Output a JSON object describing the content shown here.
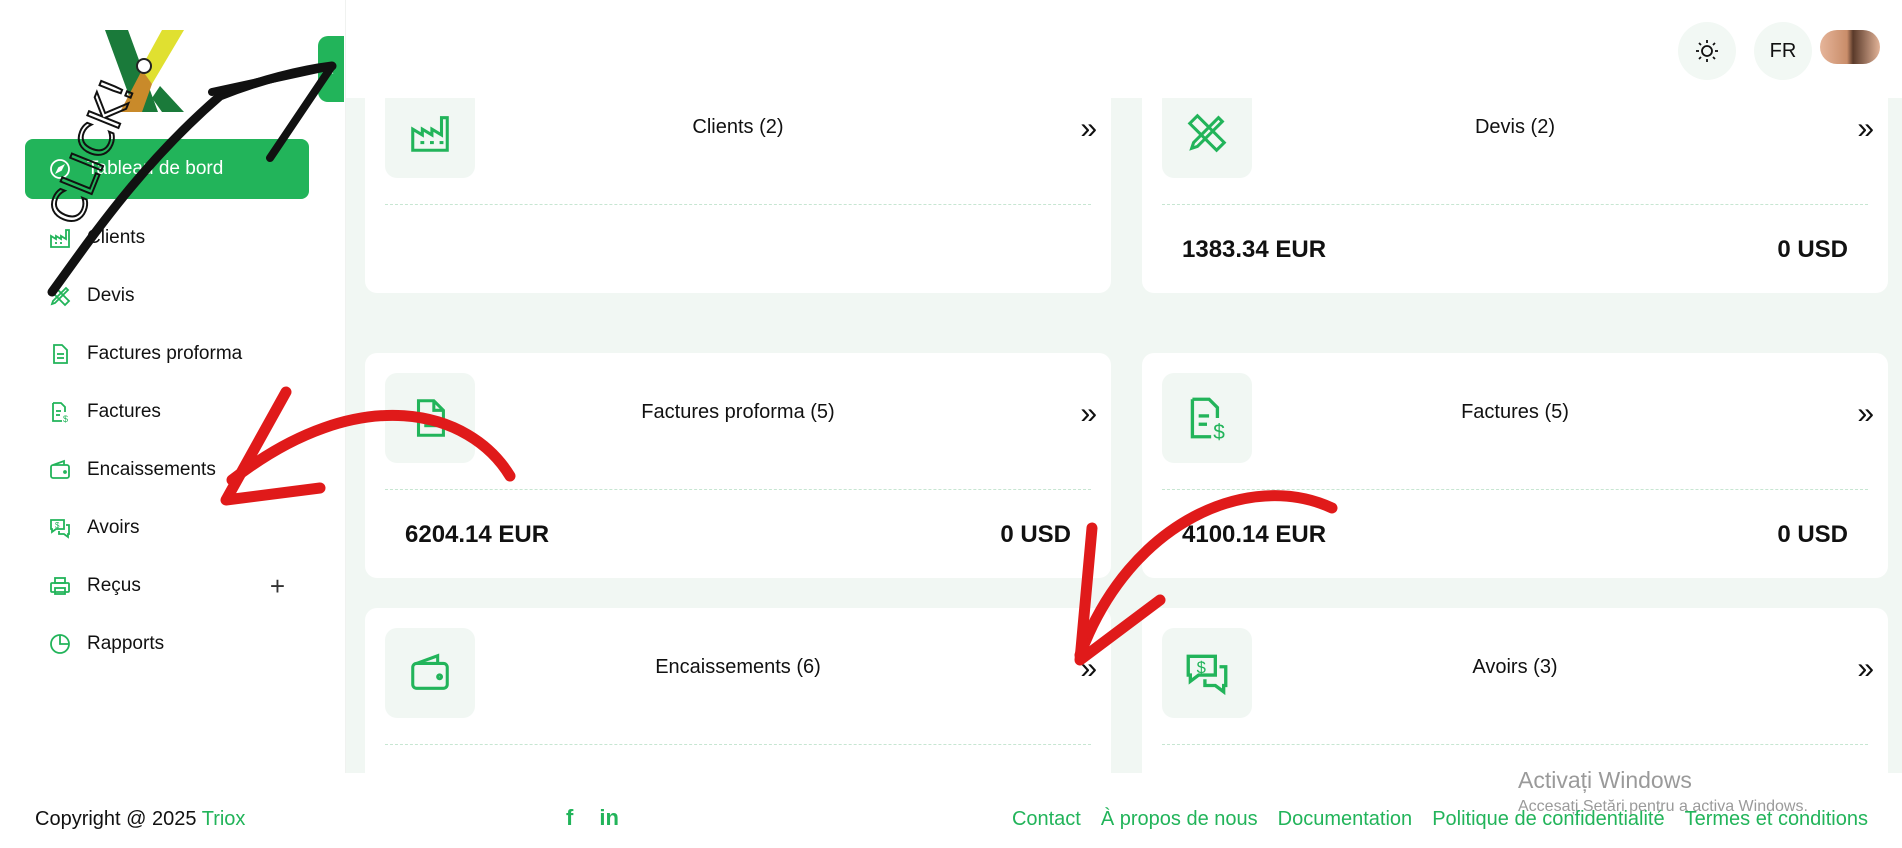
{
  "app": {
    "brand": "Triox"
  },
  "sidebar": {
    "collapse_icon": "chevron-left-icon",
    "items": [
      {
        "label": "Tableau de bord",
        "icon": "compass-icon",
        "active": true
      },
      {
        "label": "Clients",
        "icon": "factory-icon"
      },
      {
        "label": "Devis",
        "icon": "pencil-ruler-icon"
      },
      {
        "label": "Factures proforma",
        "icon": "document-icon"
      },
      {
        "label": "Factures",
        "icon": "invoice-dollar-icon"
      },
      {
        "label": "Encaissements",
        "icon": "wallet-icon"
      },
      {
        "label": "Avoirs",
        "icon": "chat-dollar-icon"
      },
      {
        "label": "Reçus",
        "icon": "printer-icon",
        "expand": "+"
      },
      {
        "label": "Rapports",
        "icon": "pie-chart-icon"
      }
    ]
  },
  "header": {
    "theme_icon": "sun-icon",
    "language": "FR",
    "avatar": "user-avatar"
  },
  "cards": [
    {
      "title": "Clients (2)",
      "icon": "factory-icon",
      "value_eur": "",
      "value_usd": ""
    },
    {
      "title": "Devis (2)",
      "icon": "pencil-ruler-icon",
      "value_eur": "1383.34 EUR",
      "value_usd": "0 USD"
    },
    {
      "title": "Factures proforma (5)",
      "icon": "document-icon",
      "value_eur": "6204.14 EUR",
      "value_usd": "0 USD"
    },
    {
      "title": "Factures (5)",
      "icon": "invoice-dollar-icon",
      "value_eur": "4100.14 EUR",
      "value_usd": "0 USD"
    },
    {
      "title": "Encaissements (6)",
      "icon": "wallet-icon",
      "value_eur": "",
      "value_usd": ""
    },
    {
      "title": "Avoirs (3)",
      "icon": "chat-dollar-icon",
      "value_eur": "",
      "value_usd": ""
    }
  ],
  "footer": {
    "copyright": "Copyright @ 2025",
    "brand": "Triox",
    "social": [
      "facebook-icon",
      "linkedin-icon"
    ],
    "links": [
      "Contact",
      "À propos de nous",
      "Documentation",
      "Politique de confidentialité",
      "Termes et conditions"
    ]
  },
  "annotation": {
    "click_text": "CLICK!"
  },
  "watermark": {
    "line1": "Activați Windows",
    "line2": "Accesați Setări pentru a activa Windows."
  },
  "colors": {
    "accent": "#22b45a",
    "background": "#f1f7f3",
    "annotation_red": "#e01a1a"
  }
}
